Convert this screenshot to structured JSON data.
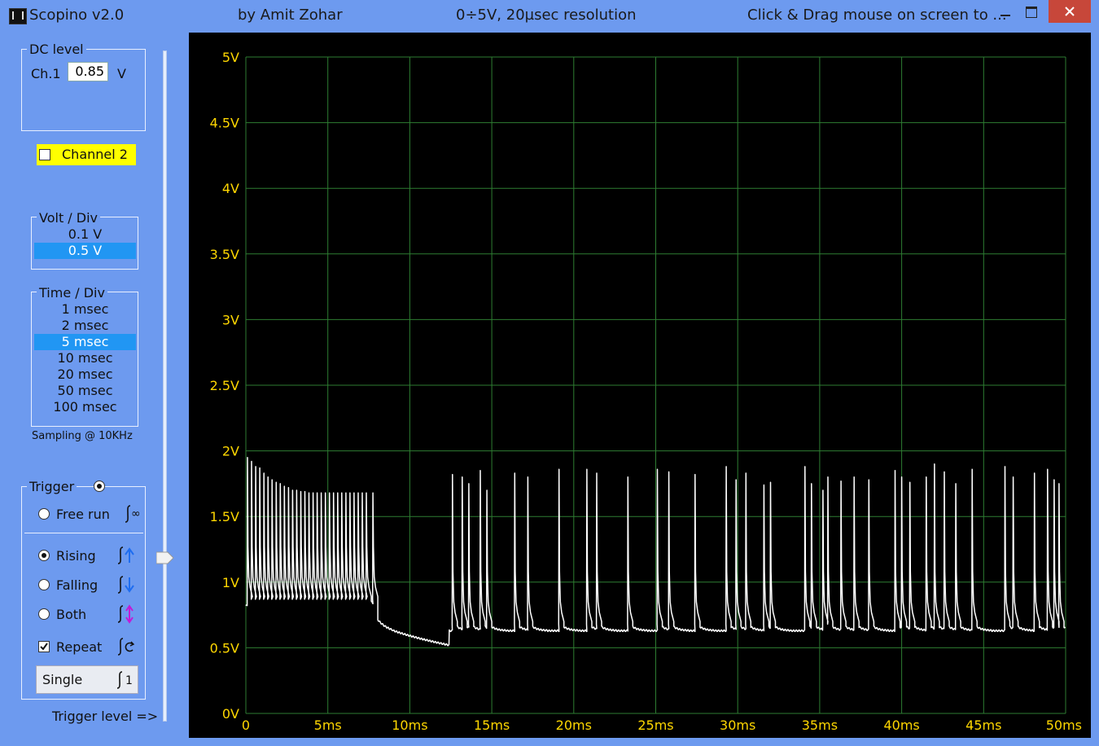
{
  "title_bar": {
    "app_title": "Scopino v2.0",
    "author": "by Amit Zohar",
    "spec": "0÷5V, 20µsec resolution",
    "hint": "Click & Drag mouse on screen to ..."
  },
  "dc_level": {
    "group_label": "DC level",
    "channel_label": "Ch.1",
    "value": "0.85",
    "unit": "V"
  },
  "channel2": {
    "label": "Channel 2",
    "checked": false
  },
  "volt_div": {
    "group_label": "Volt / Div",
    "options": [
      "0.1 V",
      "0.5 V"
    ],
    "selected_index": 1
  },
  "time_div": {
    "group_label": "Time / Div",
    "options": [
      "1 msec",
      "2 msec",
      "5 msec",
      "10 msec",
      "20 msec",
      "50 msec",
      "100 msec"
    ],
    "selected_index": 2
  },
  "sampling_text": "Sampling @ 10KHz",
  "trigger": {
    "group_label": "Trigger",
    "free_run": "Free run",
    "rising": "Rising",
    "falling": "Falling",
    "both": "Both",
    "repeat": "Repeat",
    "repeat_checked": true,
    "selected_mode": "rising",
    "single_button": "Single",
    "single_icon_num": "1",
    "trigger_level_label": "Trigger level =>",
    "trigger_level_volts": 0.85
  },
  "colors": {
    "panel": "#6d9aef",
    "grid": "#2e7d32",
    "trace": "#ffffff",
    "axis_labels": "#ffd700",
    "selection": "#2196f3",
    "highlight": "#ffff00"
  },
  "chart_data": {
    "type": "line",
    "title": "",
    "xlabel": "",
    "ylabel": "",
    "xlim": [
      0,
      50
    ],
    "ylim": [
      0,
      5
    ],
    "x_ticks": [
      "0",
      "5ms",
      "10ms",
      "15ms",
      "20ms",
      "25ms",
      "30ms",
      "35ms",
      "40ms",
      "45ms",
      "50ms"
    ],
    "y_ticks": [
      "0V",
      "0.5V",
      "1V",
      "1.5V",
      "2V",
      "2.5V",
      "3V",
      "3.5V",
      "4V",
      "4.5V",
      "5V"
    ],
    "grid": true,
    "series": [
      {
        "spike_times_ms": [
          0.1,
          0.35,
          0.6,
          0.85,
          1.1,
          1.35,
          1.6,
          1.85,
          2.1,
          2.35,
          2.6,
          2.85,
          3.1,
          3.35,
          3.6,
          3.85,
          4.1,
          4.35,
          4.6,
          4.85,
          5.1,
          5.35,
          5.6,
          5.85,
          6.1,
          6.35,
          6.6,
          6.85,
          7.1,
          7.35,
          7.75,
          12.6,
          13.2,
          13.6,
          14.3,
          14.7,
          16.4,
          17.2,
          19.1,
          20.8,
          21.4,
          23.3,
          25.1,
          25.8,
          27.4,
          29.3,
          29.9,
          30.5,
          31.6,
          32.0,
          34.1,
          34.5,
          35.2,
          35.5,
          36.3,
          37.1,
          38.0,
          39.6,
          40.0,
          40.5,
          41.5,
          42.0,
          42.6,
          43.3,
          44.3,
          46.3,
          46.8,
          48.1,
          48.9,
          49.3,
          49.6
        ],
        "spike_peaks_v": [
          1.95,
          1.92,
          1.88,
          1.87,
          1.83,
          1.8,
          1.78,
          1.76,
          1.75,
          1.73,
          1.72,
          1.7,
          1.7,
          1.69,
          1.69,
          1.68,
          1.68,
          1.68,
          1.68,
          1.68,
          1.68,
          1.68,
          1.68,
          1.68,
          1.68,
          1.68,
          1.68,
          1.68,
          1.68,
          1.68,
          1.68,
          1.82,
          1.8,
          1.75,
          1.85,
          1.7,
          1.83,
          1.8,
          1.86,
          1.86,
          1.83,
          1.8,
          1.86,
          1.84,
          1.82,
          1.88,
          1.78,
          1.83,
          1.74,
          1.76,
          1.88,
          1.75,
          1.7,
          1.8,
          1.77,
          1.8,
          1.78,
          1.85,
          1.8,
          1.76,
          1.8,
          1.9,
          1.84,
          1.75,
          1.86,
          1.88,
          1.8,
          1.83,
          1.86,
          1.78,
          1.75
        ],
        "baseline_v": {
          "burst_0_to_7.8ms": 0.82,
          "quiet_8_to_12ms_start": 0.72,
          "quiet_8_to_12ms_end": 0.52,
          "after_12.5ms": 0.63
        }
      }
    ]
  }
}
